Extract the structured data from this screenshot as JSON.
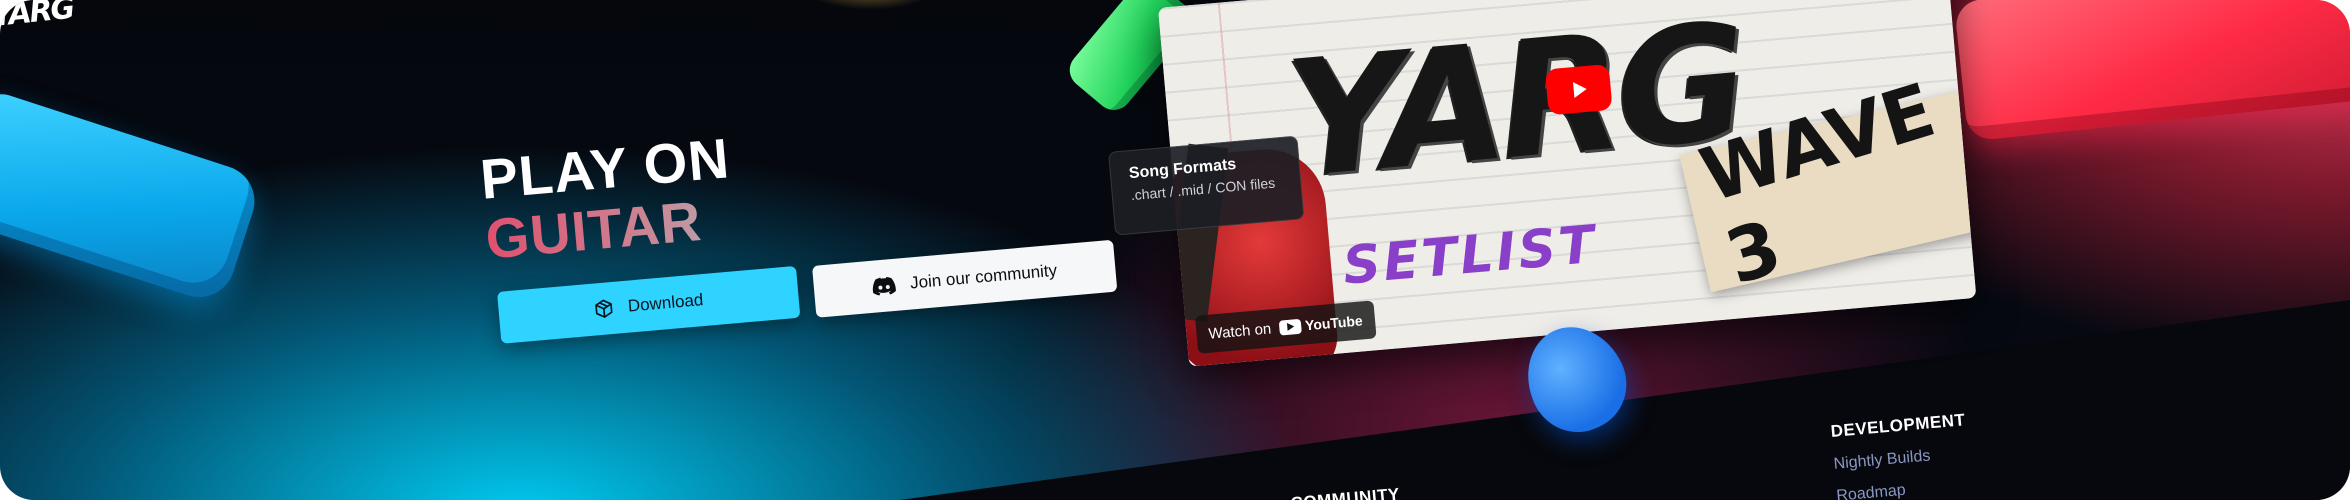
{
  "brand": {
    "logo_text": "YARG"
  },
  "hero": {
    "line1": "PLAY ON",
    "line2": "GUITAR",
    "download_label": "Download",
    "community_label": "Join our community"
  },
  "video": {
    "logo_text": "YARG",
    "setlist_text": "SETLIST",
    "wave_text": "WAVE 3",
    "watch_on_label": "Watch on",
    "youtube_label": "YouTube"
  },
  "tooltip": {
    "title": "Song Formats",
    "subtitle": ".chart / .mid / CON files"
  },
  "footer": {
    "development": {
      "heading": "DEVELOPMENT",
      "links": [
        "Nightly Builds",
        "Roadmap"
      ]
    },
    "community": {
      "heading": "COMMUNITY"
    }
  },
  "colors": {
    "download_button": "#2ed3ff",
    "community_button": "#f6f7f9",
    "accent_red": "#ff2b45",
    "accent_cyan": "#00d7ff",
    "footer_link": "#8a97c4"
  },
  "icons": {
    "download_button_icon": "package-box-icon",
    "community_button_icon": "discord-icon",
    "video_play_icon": "youtube-play-icon"
  }
}
